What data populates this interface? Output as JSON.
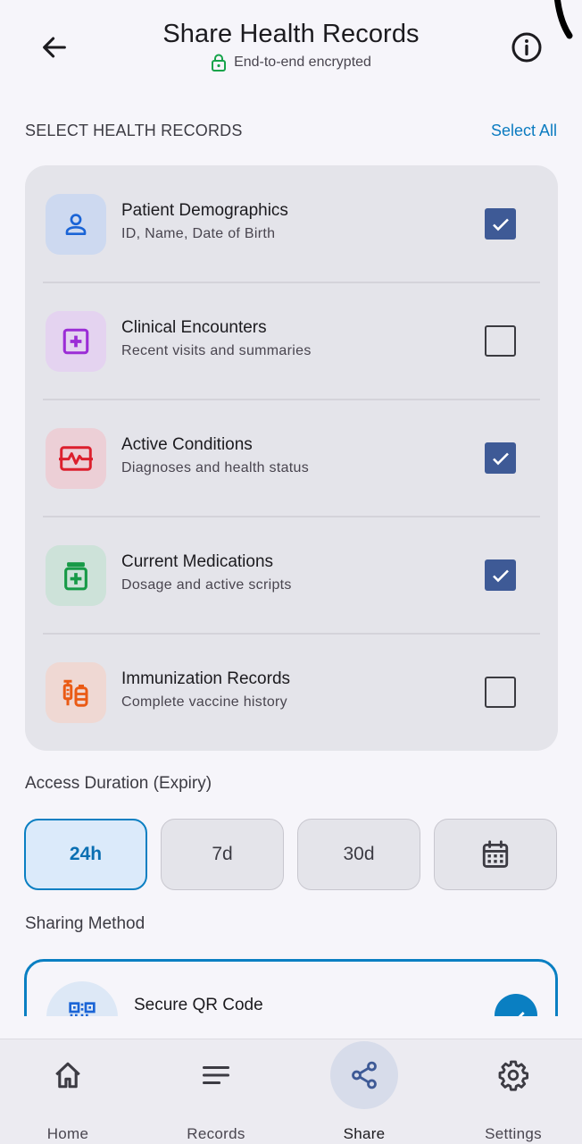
{
  "header": {
    "title": "Share Health Records",
    "subtitle": "End-to-end encrypted",
    "back_icon": "arrow-left-icon",
    "info_icon": "info-icon",
    "lock_icon": "lock-icon"
  },
  "records_section": {
    "label": "SELECT HEALTH RECORDS",
    "select_all": "Select All",
    "items": [
      {
        "name": "Patient Demographics",
        "desc": "ID, Name, Date of Birth",
        "icon": "person-icon",
        "checked": true,
        "icon_bg": "#cdd9f0",
        "icon_color": "#1a64d6"
      },
      {
        "name": "Clinical Encounters",
        "desc": "Recent visits and summaries",
        "icon": "medical-plus-icon",
        "checked": false,
        "icon_bg": "#e4d3f0",
        "icon_color": "#9b2dd6"
      },
      {
        "name": "Active Conditions",
        "desc": "Diagnoses and health status",
        "icon": "heart-monitor-icon",
        "checked": true,
        "icon_bg": "#eccfd6",
        "icon_color": "#dc1f2d"
      },
      {
        "name": "Current Medications",
        "desc": "Dosage and active scripts",
        "icon": "medication-icon",
        "checked": true,
        "icon_bg": "#cde2d9",
        "icon_color": "#179a47"
      },
      {
        "name": "Immunization Records",
        "desc": "Complete vaccine history",
        "icon": "vaccine-icon",
        "checked": false,
        "icon_bg": "#efd8d3",
        "icon_color": "#ea5a14"
      }
    ]
  },
  "access": {
    "label": "Access Duration (Expiry)",
    "options": [
      {
        "label": "24h",
        "selected": true
      },
      {
        "label": "7d",
        "selected": false
      },
      {
        "label": "30d",
        "selected": false
      },
      {
        "label": "",
        "icon": "calendar-icon",
        "selected": false
      }
    ]
  },
  "sharing": {
    "label": "Sharing Method",
    "method_name": "Secure QR Code",
    "method_icon": "qr-code-icon",
    "selected": true
  },
  "nav": {
    "items": [
      {
        "label": "Home",
        "icon": "home-icon",
        "active": false
      },
      {
        "label": "Records",
        "icon": "menu-lines-icon",
        "active": false
      },
      {
        "label": "Share",
        "icon": "share-icon",
        "active": true
      },
      {
        "label": "Settings",
        "icon": "gear-icon",
        "active": false
      }
    ]
  },
  "colors": {
    "accent": "#0a7fc2",
    "checkbox_checked": "#3e5a96",
    "lock_green": "#16a34a"
  }
}
